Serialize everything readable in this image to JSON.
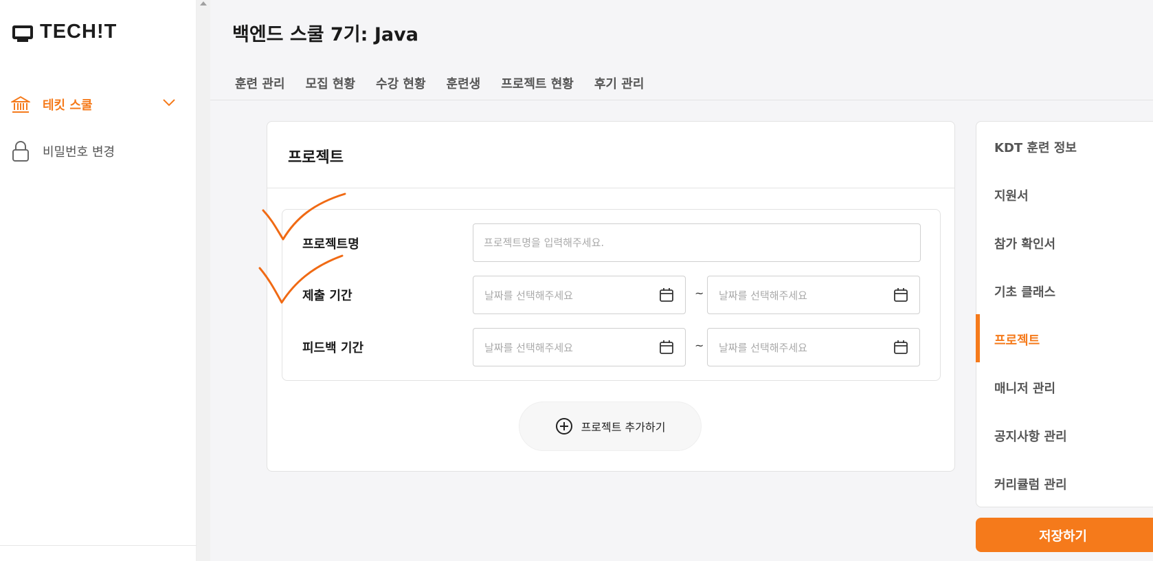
{
  "app": {
    "logo": "TECH!T"
  },
  "sidebar": {
    "items": [
      {
        "label": "테킷 스쿨",
        "icon": "bank-icon",
        "active": true
      },
      {
        "label": "비밀번호 변경",
        "icon": "lock-icon",
        "active": false
      }
    ]
  },
  "header": {
    "title": "백엔드 스쿨 7기: Java",
    "tabs": [
      "훈련 관리",
      "모집 현황",
      "수강 현황",
      "훈련생",
      "프로젝트 현황",
      "후기 관리"
    ]
  },
  "project_card": {
    "title": "프로젝트",
    "fields": {
      "name_label": "프로젝트명",
      "name_placeholder": "프로젝트명을 입력해주세요.",
      "submit_label": "제출 기간",
      "feedback_label": "피드백 기간",
      "date_placeholder": "날짜를 선택해주세요",
      "range_sep": "~"
    },
    "add_button": "프로젝트 추가하기"
  },
  "right_nav": {
    "items": [
      "KDT 훈련 정보",
      "지원서",
      "참가 확인서",
      "기초 클래스",
      "프로젝트",
      "매니저 관리",
      "공지사항 관리",
      "커리큘럼 관리"
    ],
    "active": "프로젝트"
  },
  "save_button": "저장하기",
  "colors": {
    "accent": "#f57a1b",
    "annotation": "#f06a14"
  }
}
